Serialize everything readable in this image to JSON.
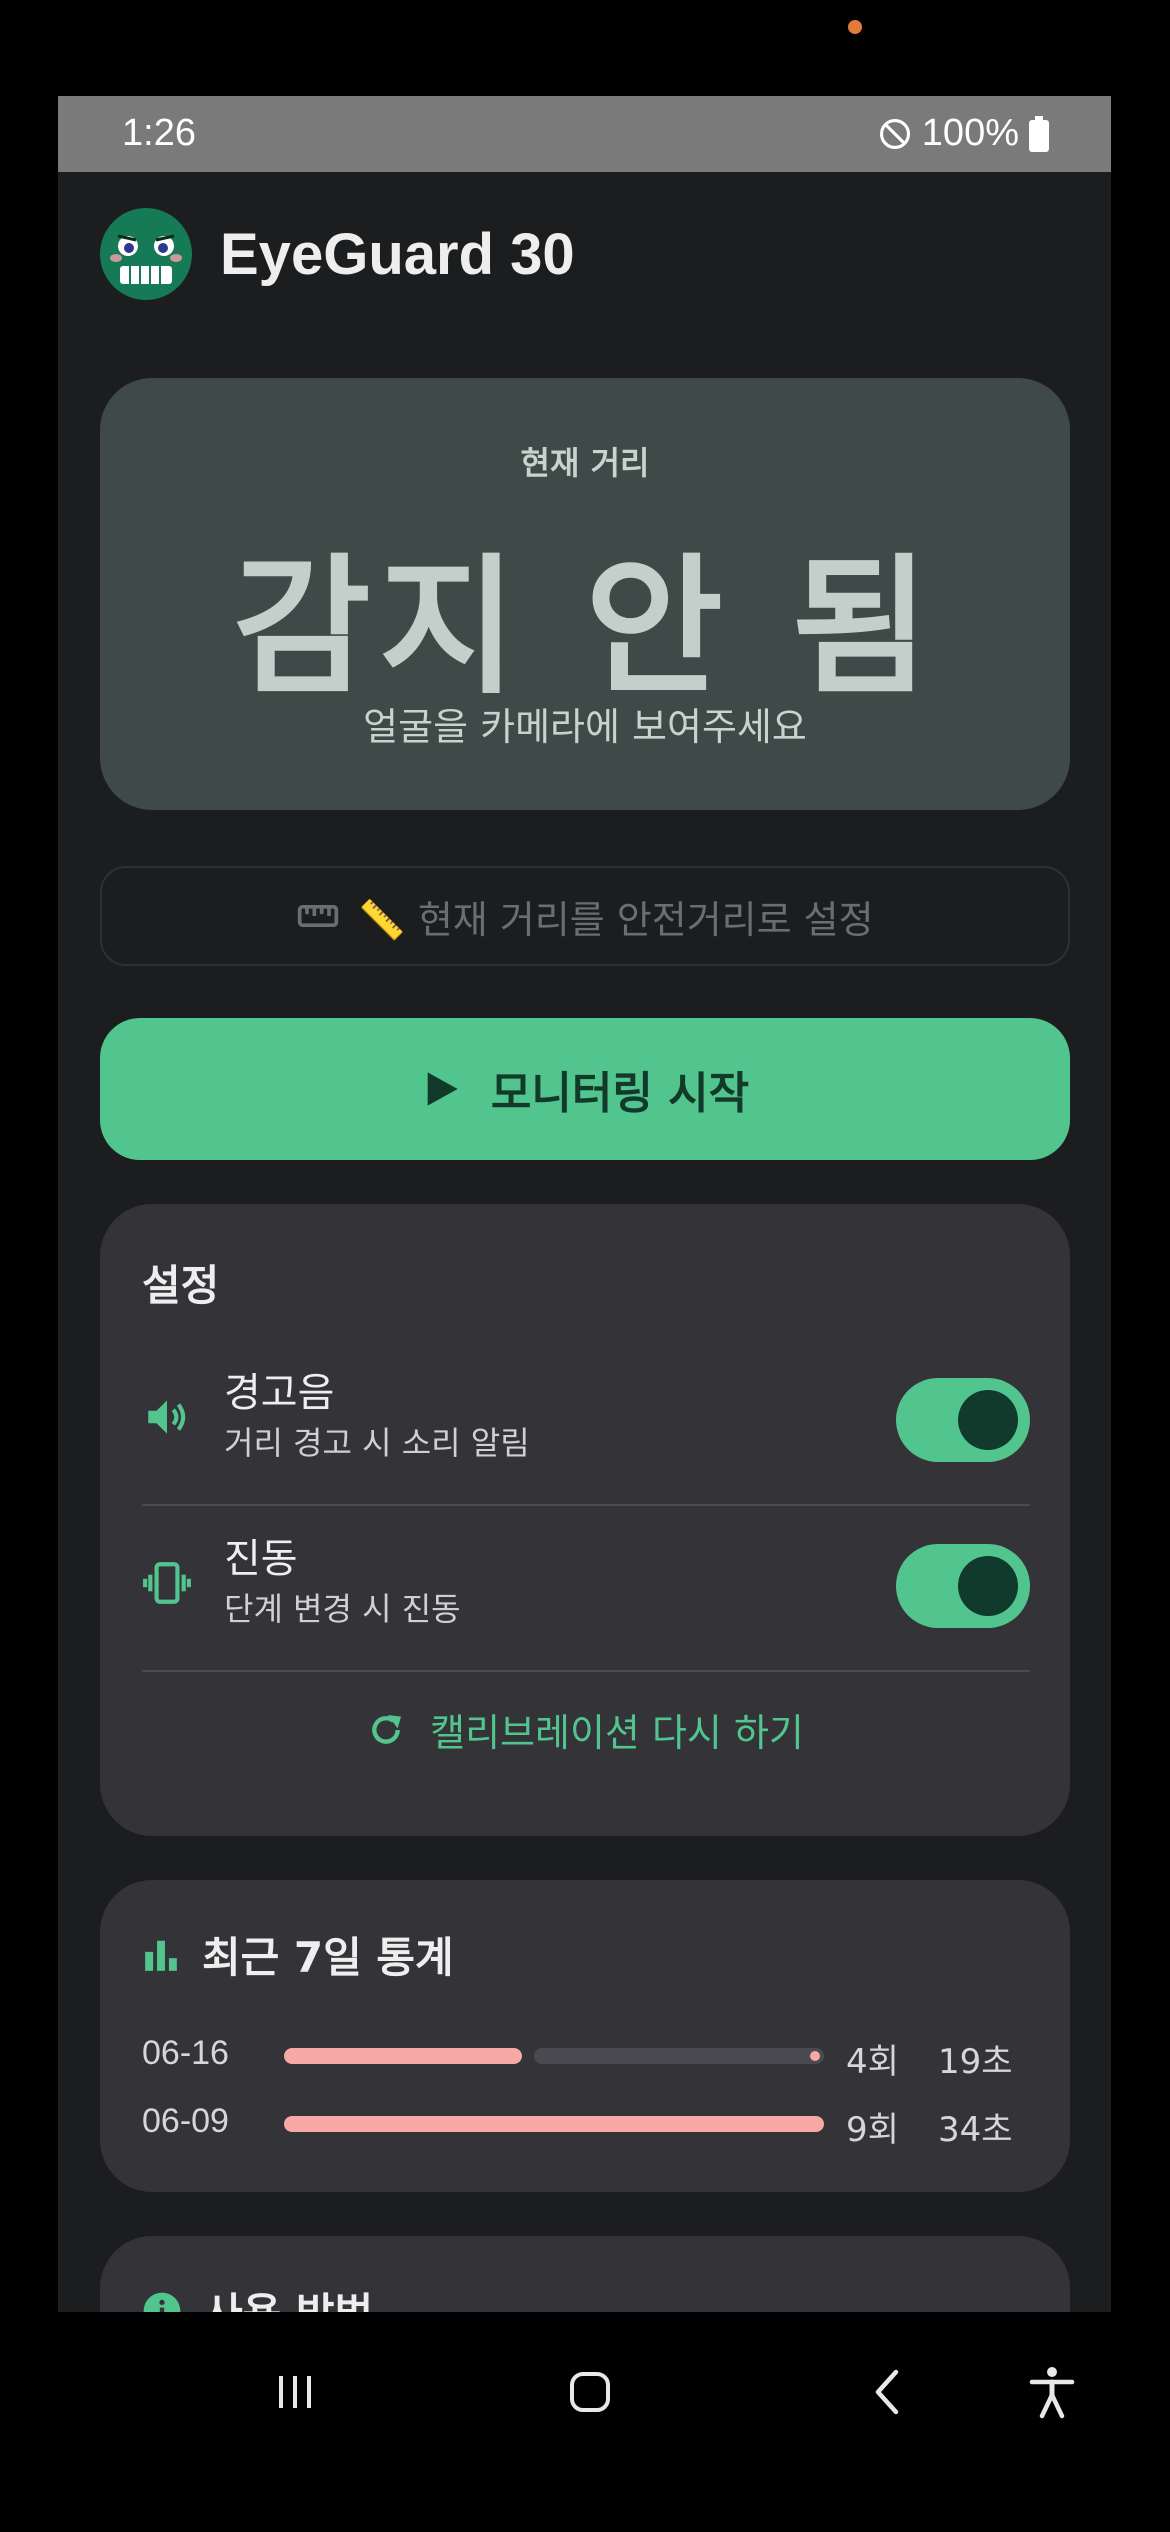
{
  "status_bar": {
    "time": "1:26",
    "battery": "100%"
  },
  "header": {
    "title": "EyeGuard 30"
  },
  "distance_card": {
    "label": "현재 거리",
    "value": "감지 안 됨",
    "hint": "얼굴을 카메라에 보여주세요"
  },
  "set_distance_button": {
    "label": "📏 현재 거리를 안전거리로 설정"
  },
  "start_button": {
    "label": "모니터링 시작"
  },
  "settings": {
    "title": "설정",
    "items": [
      {
        "label": "경고음",
        "description": "거리 경고 시 소리 알림",
        "enabled": true,
        "icon": "volume-icon"
      },
      {
        "label": "진동",
        "description": "단계 변경 시 진동",
        "enabled": true,
        "icon": "vibration-icon"
      }
    ],
    "recalibrate_label": "캘리브레이션 다시 하기"
  },
  "stats": {
    "title": "최근 7일 통계",
    "rows": [
      {
        "date": "06-16",
        "count": "4회",
        "time": "19초",
        "fraction": 0.44
      },
      {
        "date": "06-09",
        "count": "9회",
        "time": "34초",
        "fraction": 1.0
      }
    ]
  },
  "usage": {
    "title": "사용 방법"
  },
  "colors": {
    "accent": "#52c58e",
    "background": "#1c1d1f",
    "card": "#333338",
    "distance_card": "#3f4947",
    "stat_bar": "#f6a9a6"
  }
}
